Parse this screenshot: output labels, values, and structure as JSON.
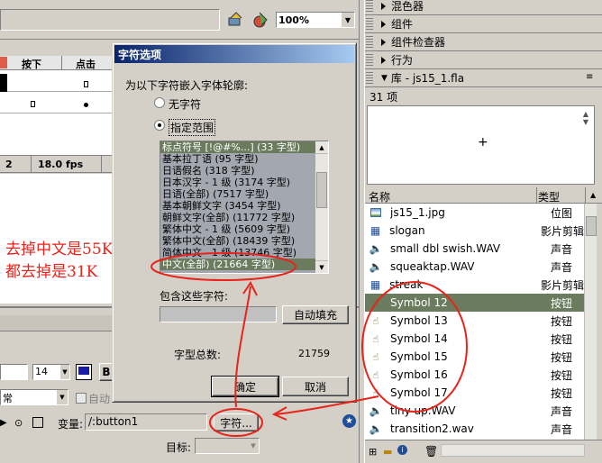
{
  "toolbar": {
    "zoom_value": "100%"
  },
  "timeline": {
    "col_down": "按下",
    "col_hit": "点击",
    "frame": "2",
    "fps": "18.0 fps"
  },
  "annotation": {
    "line1": "去掉中文是55K",
    "line2": "都去掉是31K"
  },
  "props": {
    "font_size": "14",
    "style_value": "常",
    "auto_label": "自动",
    "var_label": "变量:",
    "var_value": "/:button1",
    "char_button": "字符...",
    "target_label": "目标:"
  },
  "dialog": {
    "title": "字符选项",
    "prompt": "为以下字符嵌入字体轮廓:",
    "radio_none": "无字符",
    "radio_range": "指定范围",
    "ranges": [
      "标点符号 [!@#%...] (33 字型)",
      "基本拉丁语 (95 字型)",
      "日语假名 (318 字型)",
      "日本汉字 - 1 级 (3174 字型)",
      "日语(全部) (7517 字型)",
      "基本朝鲜文字 (3454 字型)",
      "朝鲜文字(全部) (11772 字型)",
      "繁体中文 - 1 级 (5609 字型)",
      "繁体中文(全部) (18439 字型)",
      "简体中文 - 1 级 (13746 字型)",
      "中文(全部) (21664 字型)"
    ],
    "include_label": "包含这些字符:",
    "include_value": "",
    "autofill_button": "自动填充",
    "total_label": "字型总数:",
    "total_value": "21759",
    "ok_button": "确定",
    "cancel_button": "取消"
  },
  "panels": {
    "mixer": "混色器",
    "components": "组件",
    "inspector": "组件检查器",
    "behavior": "行为",
    "library": "库 - js15_1.fla"
  },
  "library": {
    "count": "31 项",
    "preview_symbol": "+",
    "col_name": "名称",
    "col_type": "类型",
    "items": [
      {
        "icon": "bitmap-icon",
        "name": "js15_1.jpg",
        "type": "位图",
        "selected": false
      },
      {
        "icon": "movieclip-icon",
        "name": "slogan",
        "type": "影片剪辑",
        "selected": false
      },
      {
        "icon": "sound-icon",
        "name": "small dbl swish.WAV",
        "type": "声音",
        "selected": false
      },
      {
        "icon": "sound-icon",
        "name": "squeaktap.WAV",
        "type": "声音",
        "selected": false
      },
      {
        "icon": "movieclip-icon",
        "name": "streak",
        "type": "影片剪辑",
        "selected": false
      },
      {
        "icon": "button-icon",
        "name": "Symbol 12",
        "type": "按钮",
        "selected": true
      },
      {
        "icon": "button-icon",
        "name": "Symbol 13",
        "type": "按钮",
        "selected": false
      },
      {
        "icon": "button-icon",
        "name": "Symbol 14",
        "type": "按钮",
        "selected": false
      },
      {
        "icon": "button-icon",
        "name": "Symbol 15",
        "type": "按钮",
        "selected": false
      },
      {
        "icon": "button-icon",
        "name": "Symbol 16",
        "type": "按钮",
        "selected": false
      },
      {
        "icon": "button-icon",
        "name": "Symbol 17",
        "type": "按钮",
        "selected": false
      },
      {
        "icon": "sound-icon",
        "name": "tiny up.WAV",
        "type": "声音",
        "selected": false
      },
      {
        "icon": "sound-icon",
        "name": "transition2.wav",
        "type": "声音",
        "selected": false
      }
    ]
  },
  "colors": {
    "selection": "#6b7c5e",
    "annotation_red": "#e8231a",
    "list_highlight": "#6b7c5e"
  }
}
